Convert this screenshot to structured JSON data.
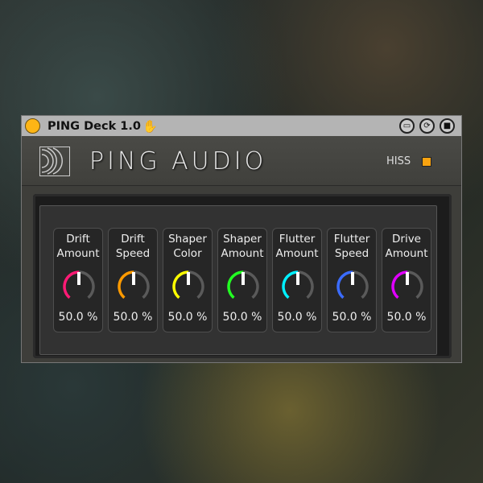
{
  "window": {
    "title": "PING Deck 1.0",
    "hand_icon": "hand-icon",
    "buttons": [
      "freeze-icon",
      "refresh-icon",
      "save-icon"
    ]
  },
  "header": {
    "brand": "PING AUDIO",
    "hiss_label": "HISS",
    "hiss_on": true,
    "hiss_color": "#f9a310"
  },
  "knobs": [
    {
      "line1": "Drift",
      "line2": "Amount",
      "value": "50.0 %",
      "fraction": 0.5,
      "color": "#ff1a75"
    },
    {
      "line1": "Drift",
      "line2": "Speed",
      "value": "50.0 %",
      "fraction": 0.5,
      "color": "#ff9a00"
    },
    {
      "line1": "Shaper",
      "line2": "Color",
      "value": "50.0 %",
      "fraction": 0.5,
      "color": "#ffff00"
    },
    {
      "line1": "Shaper",
      "line2": "Amount",
      "value": "50.0 %",
      "fraction": 0.5,
      "color": "#22ff22"
    },
    {
      "line1": "Flutter",
      "line2": "Amount",
      "value": "50.0 %",
      "fraction": 0.5,
      "color": "#00f0ff"
    },
    {
      "line1": "Flutter",
      "line2": "Speed",
      "value": "50.0 %",
      "fraction": 0.5,
      "color": "#3b6cff"
    },
    {
      "line1": "Drive",
      "line2": "Amount",
      "value": "50.0 %",
      "fraction": 0.5,
      "color": "#e000ff"
    }
  ]
}
